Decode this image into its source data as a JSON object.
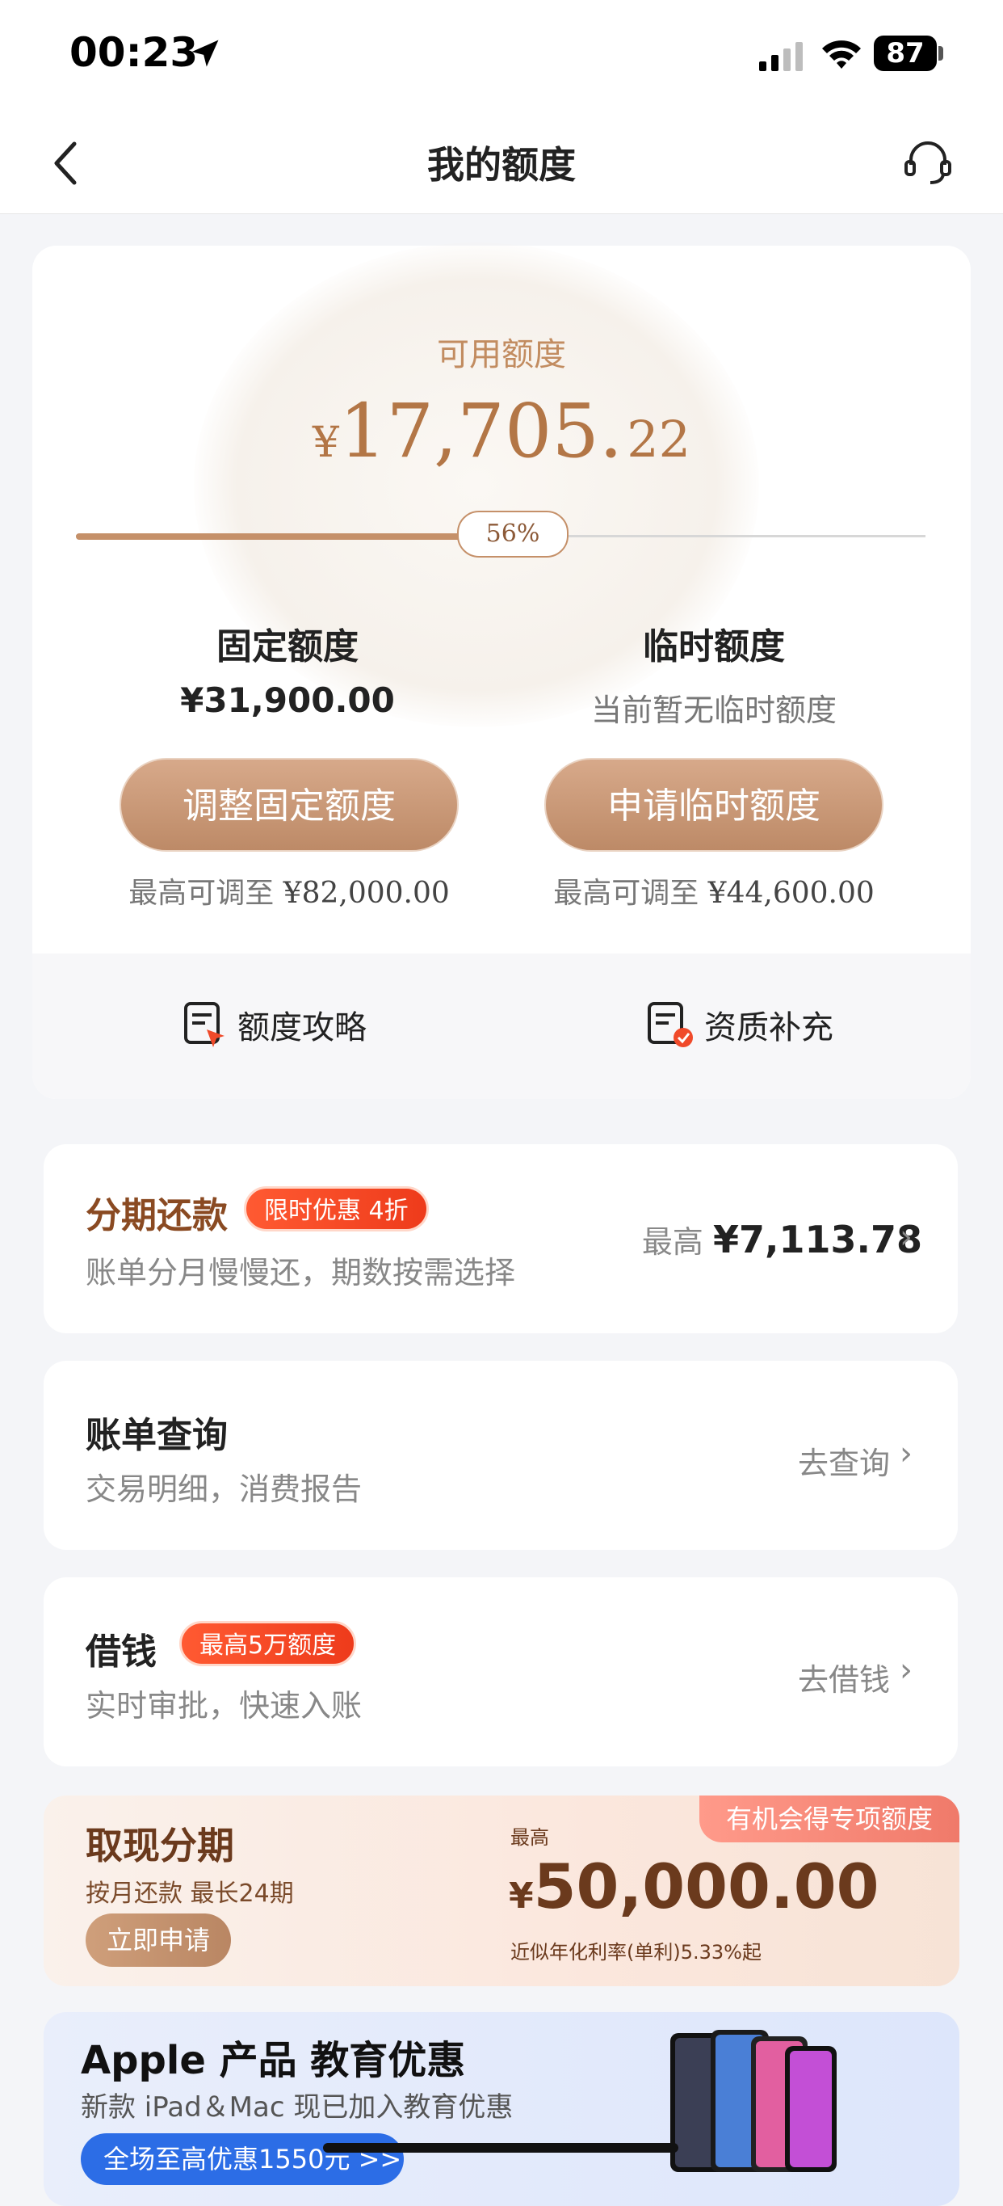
{
  "status_bar": {
    "time": "00:23",
    "battery": "87"
  },
  "nav": {
    "title": "我的额度"
  },
  "quota": {
    "available_label": "可用额度",
    "currency": "¥",
    "available_integer": "17,705.",
    "available_decimal": "22",
    "usage_percent": "56%",
    "usage_fraction": 0.56,
    "fixed": {
      "title": "固定额度",
      "value": "¥31,900.00",
      "button": "调整固定额度",
      "note_label": "最高可调至",
      "note_value": "¥82,000.00"
    },
    "temporary": {
      "title": "临时额度",
      "value": "当前暂无临时额度",
      "button": "申请临时额度",
      "note_label": "最高可调至",
      "note_value": "¥44,600.00"
    },
    "links": [
      {
        "label": "额度攻略",
        "icon": "strategy-icon"
      },
      {
        "label": "资质补充",
        "icon": "qualification-icon"
      }
    ]
  },
  "installment": {
    "title": "分期还款",
    "badge": "限时优惠 4折",
    "subtitle": "账单分月慢慢还，期数按需选择",
    "right_prefix": "最高",
    "right_value": "¥7,113.78"
  },
  "bill": {
    "title": "账单查询",
    "subtitle": "交易明细，消费报告",
    "action": "去查询"
  },
  "loan": {
    "title": "借钱",
    "badge": "最高5万额度",
    "subtitle": "实时审批，快速入账",
    "action": "去借钱"
  },
  "cash": {
    "tag": "有机会得专项额度",
    "title": "取现分期",
    "subtitle": "按月还款 最长24期",
    "button": "立即申请",
    "max_label": "最高",
    "currency": "¥",
    "amount": "50,000.00",
    "rate": "近似年化利率(单利)5.33%起"
  },
  "apple": {
    "title": "Apple 产品 教育优惠",
    "subtitle": "新款 iPad＆Mac 现已加入教育优惠",
    "button": "全场至高优惠1550元 >>"
  },
  "colors": {
    "accent": "#c59069",
    "badge": "#ee3b1b",
    "brown": "#6b3a1d"
  }
}
